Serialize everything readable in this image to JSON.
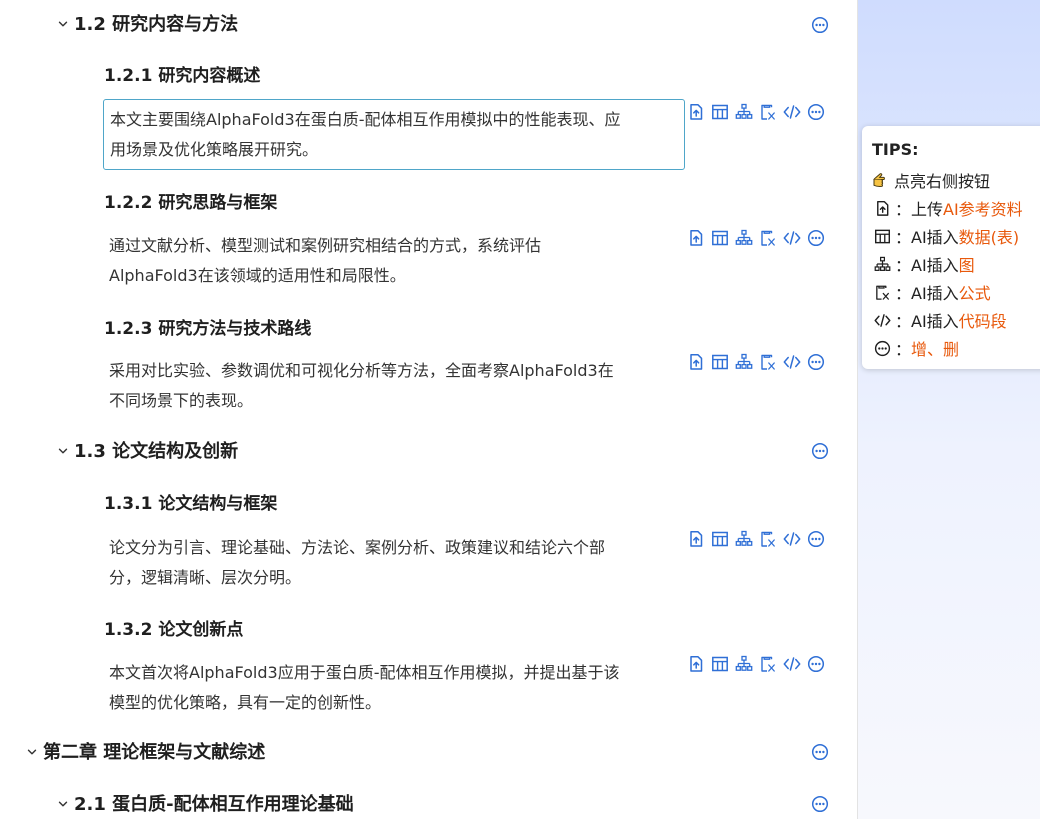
{
  "outline": {
    "s1_2": {
      "title": "1.2  研究内容与方法"
    },
    "s1_2_1": {
      "title": "1.2.1  研究内容概述",
      "text_line1": "本文主要围绕AlphaFold3在蛋白质-配体相互作用模拟中的性能表现、应",
      "text_line2": "用场景及优化策略展开研究。"
    },
    "s1_2_2": {
      "title": "1.2.2  研究思路与框架",
      "text_line1": "通过文献分析、模型测试和案例研究相结合的方式，系统评估",
      "text_line2": "AlphaFold3在该领域的适用性和局限性。"
    },
    "s1_2_3": {
      "title": "1.2.3  研究方法与技术路线",
      "text_line1": "采用对比实验、参数调优和可视化分析等方法，全面考察AlphaFold3在",
      "text_line2": "不同场景下的表现。"
    },
    "s1_3": {
      "title": "1.3  论文结构及创新"
    },
    "s1_3_1": {
      "title": "1.3.1  论文结构与框架",
      "text_line1": "论文分为引言、理论基础、方法论、案例分析、政策建议和结论六个部",
      "text_line2": "分，逻辑清晰、层次分明。"
    },
    "s1_3_2": {
      "title": "1.3.2  论文创新点",
      "text_line1": "本文首次将AlphaFold3应用于蛋白质-配体相互作用模拟，并提出基于该",
      "text_line2": "模型的优化策略，具有一定的创新性。"
    },
    "ch2": {
      "title": "第二章  理论框架与文献综述"
    },
    "s2_1": {
      "title": "2.1  蛋白质-配体相互作用理论基础"
    }
  },
  "tips": {
    "title": "TIPS:",
    "hint": "点亮右侧按钮",
    "upload_prefix": "：上传",
    "upload_highlight": "AI参考资料",
    "table_prefix": "：AI插入",
    "table_highlight": "数据(表)",
    "chart_prefix": "：AI插入",
    "chart_highlight": "图",
    "formula_prefix": "：AI插入",
    "formula_highlight": "公式",
    "code_prefix": "：AI插入",
    "code_highlight": "代码段",
    "more_prefix": "：",
    "more_highlight": "增、删"
  },
  "colors": {
    "accent_blue": "#2f6fd6",
    "highlight_orange": "#e8590c",
    "active_border": "#4fa6c9"
  },
  "icons": [
    "chevron-down-icon",
    "upload-icon",
    "table-icon",
    "org-chart-icon",
    "formula-icon",
    "code-icon",
    "more-circle-icon",
    "pointing-hand-icon"
  ]
}
